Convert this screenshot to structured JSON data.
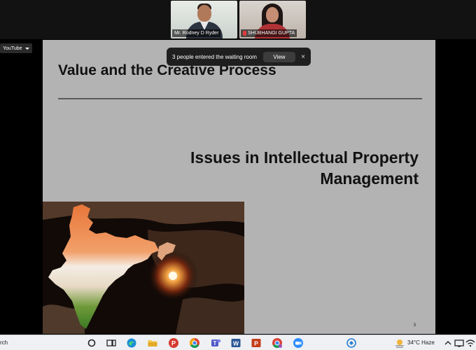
{
  "gallery": {
    "participants": [
      {
        "name": "Mr. Rodney D Ryder"
      },
      {
        "name": "SHUBHANGI GUPTA"
      }
    ]
  },
  "view_dropdown": {
    "label": "YouTube"
  },
  "notification": {
    "message": "3 people entered the waiting room",
    "action_label": "View",
    "close_glyph": "×"
  },
  "slide": {
    "title": "Value and the Creative Process",
    "subtitle": "Issues in Intellectual Property Management",
    "page_number": "3"
  },
  "taskbar": {
    "search_text": "rch",
    "apps": [
      "task-view-icon",
      "edge-icon",
      "file-explorer-icon",
      "pdf-app-icon",
      "chrome-icon",
      "teams-icon",
      "word-icon",
      "powerpoint-icon",
      "chrome-profile-icon",
      "zoom-icon",
      "network-app-icon"
    ],
    "weather": "34°C  Haze",
    "colors": {
      "edge": "#1b8ed6",
      "pdf": "#d63a2f",
      "chrome_red": "#db4437",
      "teams": "#5059c9",
      "word": "#2b5797",
      "powerpoint": "#c43e1c",
      "zoom": "#2d8cff"
    }
  }
}
